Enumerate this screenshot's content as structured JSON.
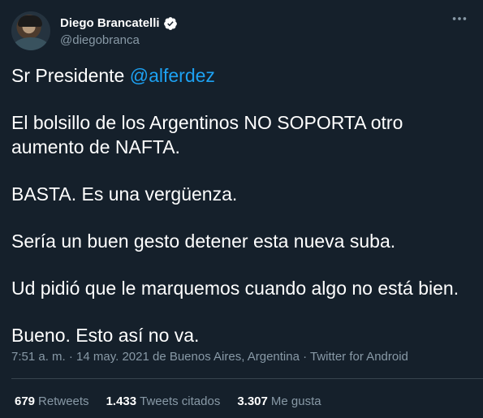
{
  "colors": {
    "background": "#15202b",
    "text": "#ffffff",
    "muted": "#8899a6",
    "accent": "#1da1f2",
    "divider": "#38444d"
  },
  "author": {
    "name": "Diego Brancatelli",
    "handle": "@diegobranca",
    "avatar_icon": "profile-photo",
    "verified_icon": "verified-badge-icon",
    "more_icon": "more-options-icon"
  },
  "tweet": {
    "line1_prefix": "Sr Presidente ",
    "mention": "@alferdez",
    "paragraphs": [
      "El bolsillo de los Argentinos NO SOPORTA otro aumento de NAFTA.",
      "BASTA. Es una vergüenza.",
      "Sería un buen gesto detener esta nueva suba.",
      "Ud pidió que le marquemos cuando algo no está bien.",
      "Bueno. Esto así no va."
    ],
    "meta": "7:51 a. m. · 14 may. 2021 de Buenos Aires, Argentina · Twitter for Android"
  },
  "stats": {
    "retweets_count": "679",
    "retweets_label": "Retweets",
    "quotes_count": "1.433",
    "quotes_label": "Tweets citados",
    "likes_count": "3.307",
    "likes_label": "Me gusta"
  }
}
